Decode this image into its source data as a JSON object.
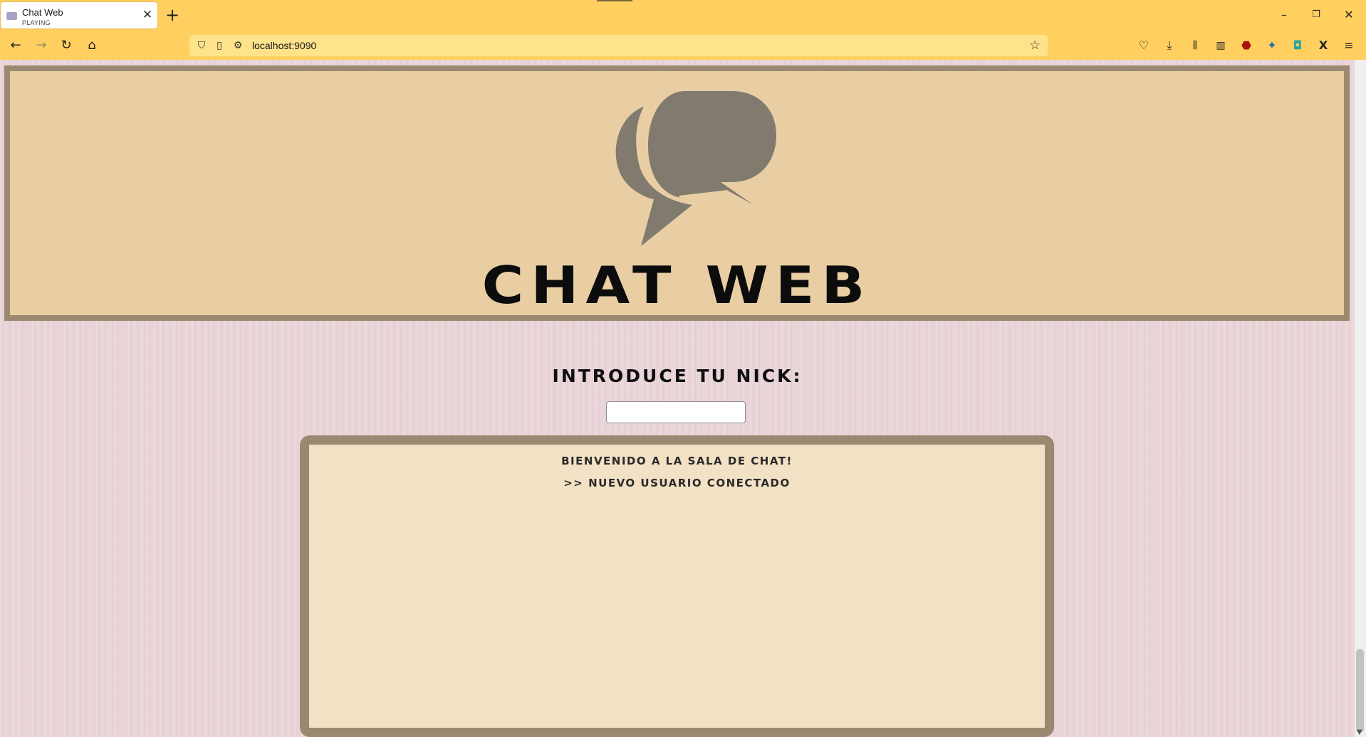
{
  "browser": {
    "tab": {
      "title": "Chat Web",
      "subtitle": "PLAYING",
      "close_icon": "close-icon"
    },
    "new_tab_icon": "plus-icon",
    "url": "localhost:9090",
    "window_controls": [
      "minimize-icon",
      "restore-icon",
      "close-icon"
    ],
    "toolbar_icons": [
      "pocket-icon",
      "download-icon",
      "library-icon",
      "sidebar-icon",
      "ublock-icon",
      "extension-blue-icon",
      "extension-teal-icon",
      "x-icon",
      "menu-icon"
    ]
  },
  "page": {
    "brand": "CHAT WEB",
    "nick_label": "INTRODUCE TU NICK:",
    "nick_value": "",
    "messages": [
      "BIENVENIDO A LA SALA DE CHAT!",
      ">> NUEVO USUARIO CONECTADO"
    ]
  },
  "colors": {
    "chrome": "#ffd060",
    "header_bg": "#e9cea4",
    "frame": "#9a8970",
    "bubble": "#807b6e",
    "chat_bg": "#f2e1c4"
  }
}
